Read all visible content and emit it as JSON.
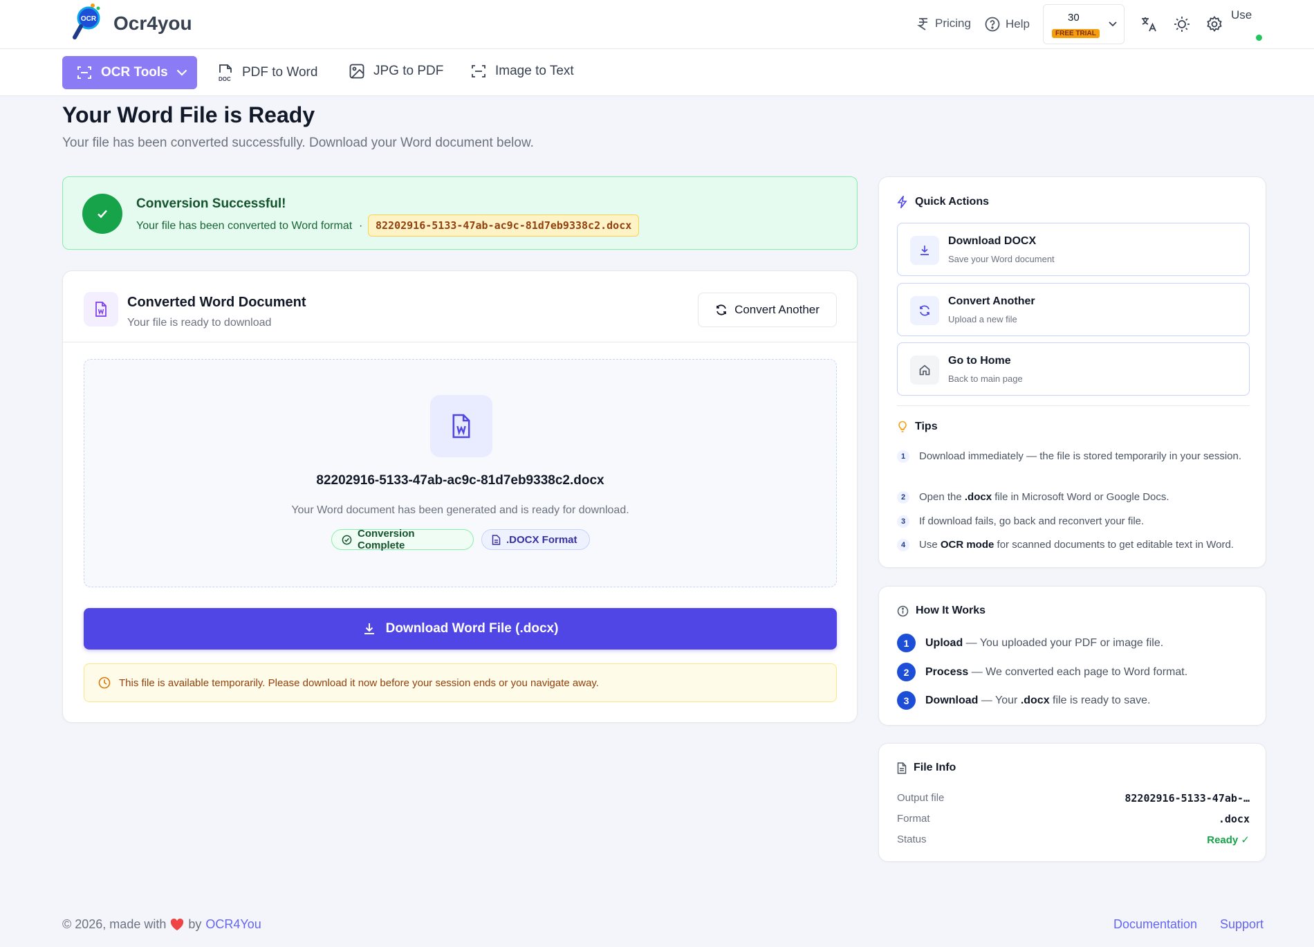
{
  "app": {
    "brand": "Ocr4you",
    "logo_text": "OCR"
  },
  "topbar": {
    "pricing": "Pricing",
    "help": "Help",
    "credits": "30",
    "trial_badge": "FREE TRIAL",
    "avatar_alt": "Use",
    "icons": [
      "rupee-icon",
      "help-circle-icon",
      "translate-icon",
      "sun-icon",
      "gear-icon"
    ]
  },
  "nav": {
    "ocr_tools": "OCR Tools",
    "pdf_to_word": "PDF to Word",
    "jpg_to_pdf": "JPG to PDF",
    "image_to_text": "Image to Text"
  },
  "page": {
    "title": "Your Word File is Ready",
    "subtitle": "Your file has been converted successfully. Download your Word document below."
  },
  "success": {
    "title": "Conversion Successful!",
    "desc": "Your file has been converted to Word format",
    "separator": "·",
    "filename": "82202916-5133-47ab-ac9c-81d7eb9338c2.docx"
  },
  "main_card": {
    "title": "Converted Word Document",
    "subtitle": "Your file is ready to download",
    "convert_another": "Convert Another",
    "filename": "82202916-5133-47ab-ac9c-81d7eb9338c2.docx",
    "desc": "Your Word document has been generated and is ready for download.",
    "badge_complete": "Conversion Complete",
    "badge_format": ".DOCX Format",
    "download_label": "Download Word File (.docx)",
    "warning": "This file is available temporarily. Please download it now before your session ends or you navigate away."
  },
  "quick_actions": {
    "title": "Quick Actions",
    "items": [
      {
        "title": "Download DOCX",
        "sub": "Save your Word document"
      },
      {
        "title": "Convert Another",
        "sub": "Upload a new file"
      },
      {
        "title": "Go to Home",
        "sub": "Back to main page"
      }
    ]
  },
  "tips": {
    "title": "Tips",
    "items": [
      {
        "n": "1",
        "pre": "Download immediately — the file is stored temporarily in your session.",
        "b": "",
        "post": ""
      },
      {
        "n": "2",
        "pre": "Open the ",
        "b": ".docx",
        "post": " file in Microsoft Word or Google Docs."
      },
      {
        "n": "3",
        "pre": "If download fails, go back and reconvert your file.",
        "b": "",
        "post": ""
      },
      {
        "n": "4",
        "pre": "Use ",
        "b": "OCR mode",
        "post": " for scanned documents to get editable text in Word."
      }
    ]
  },
  "how_it_works": {
    "title": "How It Works",
    "steps": [
      {
        "n": "1",
        "b": "Upload",
        "text": " — You uploaded your PDF or image file."
      },
      {
        "n": "2",
        "b": "Process",
        "text": " — We converted each page to Word format."
      },
      {
        "n": "3",
        "b": "Download",
        "text": " — Your ",
        "b2": ".docx",
        "text2": " file is ready to save."
      }
    ]
  },
  "file_info": {
    "title": "File Info",
    "rows": [
      {
        "k": "Output file",
        "v": "82202916-5133-47ab-…"
      },
      {
        "k": "Format",
        "v": ".docx"
      },
      {
        "k": "Status",
        "v": "Ready ✓"
      }
    ]
  },
  "footer": {
    "copyright": "© 2026, made with",
    "by": "by",
    "brand_link": "OCR4You",
    "documentation": "Documentation",
    "support": "Support"
  },
  "colors": {
    "primary": "#4f46e5",
    "nav_active": "#8b7cf6",
    "success": "#16a34a",
    "warning_bg": "#fefce8"
  }
}
